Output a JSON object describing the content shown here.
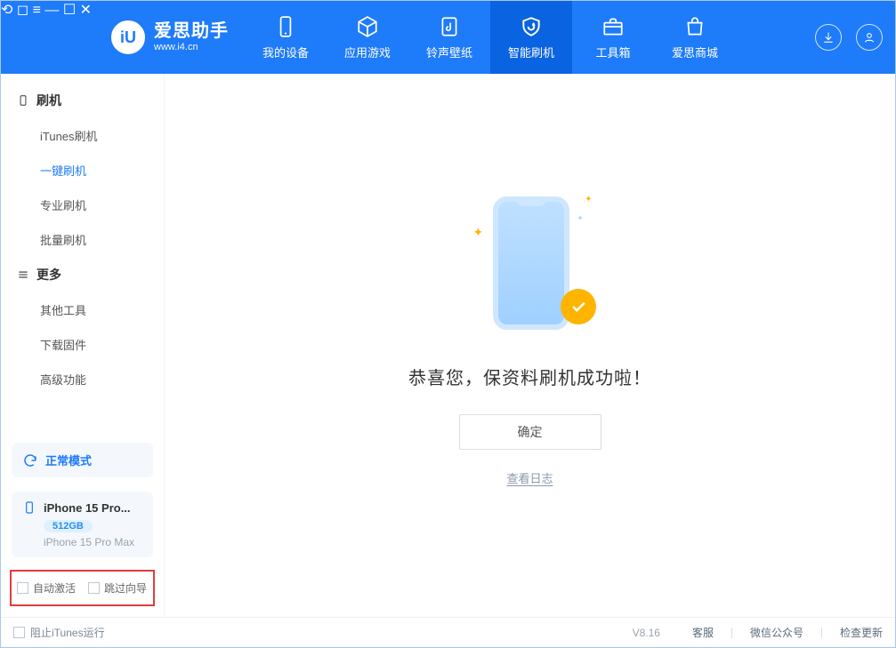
{
  "brand": {
    "title": "爱思助手",
    "subtitle": "www.i4.cn",
    "logo_text": "iU"
  },
  "nav": {
    "items": [
      {
        "label": "我的设备"
      },
      {
        "label": "应用游戏"
      },
      {
        "label": "铃声壁纸"
      },
      {
        "label": "智能刷机"
      },
      {
        "label": "工具箱"
      },
      {
        "label": "爱思商城"
      }
    ]
  },
  "sidebar": {
    "section1_title": "刷机",
    "section1_items": [
      {
        "label": "iTunes刷机"
      },
      {
        "label": "一键刷机"
      },
      {
        "label": "专业刷机"
      },
      {
        "label": "批量刷机"
      }
    ],
    "section2_title": "更多",
    "section2_items": [
      {
        "label": "其他工具"
      },
      {
        "label": "下载固件"
      },
      {
        "label": "高级功能"
      }
    ],
    "mode_label": "正常模式",
    "device": {
      "name": "iPhone 15 Pro...",
      "storage": "512GB",
      "model": "iPhone 15 Pro Max"
    },
    "check_auto_activate": "自动激活",
    "check_skip_wizard": "跳过向导"
  },
  "main": {
    "success_message": "恭喜您，保资料刷机成功啦！",
    "ok_button": "确定",
    "view_log": "查看日志"
  },
  "statusbar": {
    "block_itunes": "阻止iTunes运行",
    "version": "V8.16",
    "support": "客服",
    "wechat": "微信公众号",
    "check_update": "检查更新"
  }
}
